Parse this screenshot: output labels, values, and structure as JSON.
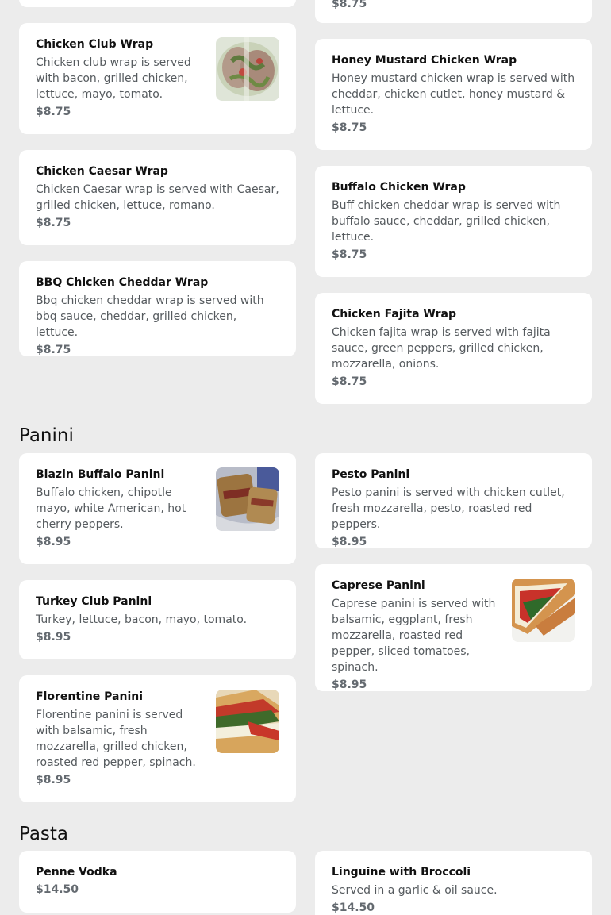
{
  "wraps": {
    "left": [
      {
        "name": "Chicken Club Wrap",
        "desc": "Chicken club wrap is served with bacon, grilled chicken, lettuce, mayo, tomato.",
        "price": "$8.75",
        "image": "chicken-club-wrap-photo"
      },
      {
        "name": "Chicken Caesar Wrap",
        "desc": "Chicken Caesar wrap is served with Caesar, grilled chicken, lettuce, romano.",
        "price": "$8.75"
      },
      {
        "name": "BBQ Chicken Cheddar Wrap",
        "desc": "Bbq chicken cheddar wrap is served with bbq sauce, cheddar, grilled chicken, lettuce.",
        "price": "$8.75"
      }
    ],
    "right_top_price": "$8.75",
    "right": [
      {
        "name": "Honey Mustard Chicken Wrap",
        "desc": "Honey mustard chicken wrap is served with cheddar, chicken cutlet, honey mustard & lettuce.",
        "price": "$8.75"
      },
      {
        "name": "Buffalo Chicken Wrap",
        "desc": "Buff chicken cheddar wrap is served with buffalo sauce, cheddar, grilled chicken, lettuce.",
        "price": "$8.75"
      },
      {
        "name": "Chicken Fajita Wrap",
        "desc": "Chicken fajita wrap is served with fajita sauce, green peppers, grilled chicken, mozzarella, onions.",
        "price": "$8.75"
      }
    ]
  },
  "panini": {
    "title": "Panini",
    "left": [
      {
        "name": "Blazin Buffalo Panini",
        "desc": "Buffalo chicken, chipotle mayo, white American, hot cherry peppers.",
        "price": "$8.95",
        "image": "blazin-buffalo-panini-photo"
      },
      {
        "name": "Turkey Club Panini",
        "desc": "Turkey, lettuce, bacon, mayo, tomato.",
        "price": "$8.95"
      },
      {
        "name": "Florentine Panini",
        "desc": "Florentine panini is served with balsamic, fresh mozzarella, grilled chicken, roasted red pepper, spinach.",
        "price": "$8.95",
        "image": "florentine-panini-photo"
      }
    ],
    "right": [
      {
        "name": "Pesto Panini",
        "desc": "Pesto panini is served with chicken cutlet, fresh mozzarella, pesto, roasted red peppers.",
        "price": "$8.95"
      },
      {
        "name": "Caprese Panini",
        "desc": "Caprese panini is served with balsamic, eggplant, fresh mozzarella, roasted red pepper, sliced tomatoes, spinach.",
        "price": "$8.95",
        "image": "caprese-panini-photo"
      }
    ]
  },
  "pasta": {
    "title": "Pasta",
    "left": [
      {
        "name": "Penne Vodka",
        "price": "$14.50"
      }
    ],
    "right": [
      {
        "name": "Linguine with Broccoli",
        "desc": "Served in a garlic & oil sauce.",
        "price": "$14.50"
      }
    ]
  }
}
